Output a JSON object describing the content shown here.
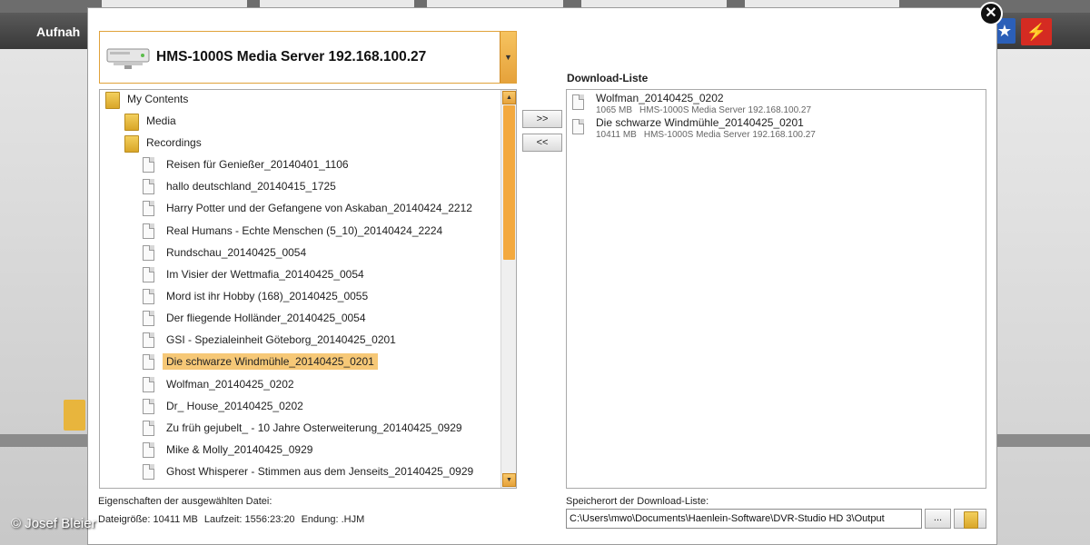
{
  "background_app": {
    "title": "Aufnah"
  },
  "dialog": {
    "server": {
      "label": "HMS-1000S Media Server 192.168.100.27"
    },
    "tree": {
      "root": "My Contents",
      "folders": [
        "Media",
        "Recordings"
      ],
      "recordings": [
        "Reisen für Genießer_20140401_1106",
        "hallo deutschland_20140415_1725",
        "Harry Potter und der Gefangene von Askaban_20140424_2212",
        "Real Humans - Echte Menschen (5_10)_20140424_2224",
        "Rundschau_20140425_0054",
        "Im Visier der Wettmafia_20140425_0054",
        "Mord ist ihr Hobby (168)_20140425_0055",
        "Der fliegende Holländer_20140425_0054",
        "GSI - Spezialeinheit Göteborg_20140425_0201",
        "Die schwarze Windmühle_20140425_0201",
        "Wolfman_20140425_0202",
        "Dr_ House_20140425_0202",
        "Zu früh gejubelt_ - 10 Jahre Osterweiterung_20140425_0929",
        "Mike & Molly_20140425_0929",
        "Ghost Whisperer - Stimmen aus dem Jenseits_20140425_0929"
      ],
      "selected": "Die schwarze Windmühle_20140425_0201"
    },
    "buttons": {
      "add": ">>",
      "remove": "<<",
      "browse": "..."
    },
    "download_list": {
      "heading": "Download-Liste",
      "items": [
        {
          "name": "Wolfman_20140425_0202",
          "size": "1065 MB",
          "server": "HMS-1000S Media Server 192.168.100.27"
        },
        {
          "name": "Die schwarze Windmühle_20140425_0201",
          "size": "10411 MB",
          "server": "HMS-1000S Media Server 192.168.100.27"
        }
      ]
    },
    "properties": {
      "title": "Eigenschaften der ausgewählten Datei:",
      "size": "Dateigröße: 10411 MB",
      "duration": "Laufzeit:  1556:23:20",
      "extension": "Endung: .HJM"
    },
    "save_location": {
      "title": "Speicherort der Download-Liste:",
      "value": "C:\\Users\\mwo\\Documents\\Haenlein-Software\\DVR-Studio HD 3\\Output"
    }
  },
  "watermark": "© Josef Bleier",
  "colors": {
    "accent": "#f3a93f",
    "selection": "#f6c877",
    "brand_blue": "#2b5fb8",
    "brand_red": "#d52b22"
  }
}
